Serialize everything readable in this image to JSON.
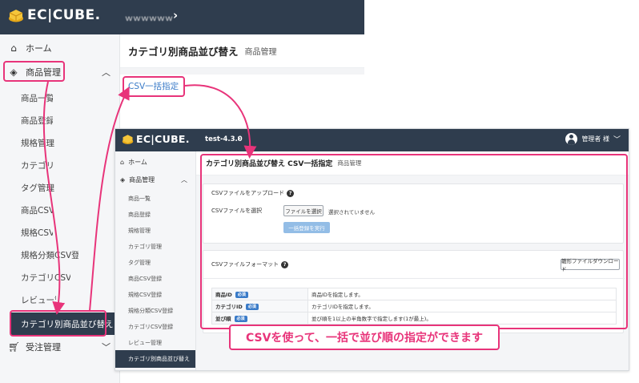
{
  "brand": {
    "logo_text": "EC|CUBE.",
    "accent": "#e8347a",
    "header_bg": "#2f3d4e",
    "link": "#3a7bc8"
  },
  "outer": {
    "shop_name": "ｗｗｗｗｗｗ",
    "nav": {
      "home": "ホーム",
      "products": "商品管理",
      "orders": "受注管理"
    },
    "sub_items": [
      "商品一覧",
      "商品登録",
      "規格管理",
      "カテゴリ管理",
      "タグ管理",
      "商品CSV登録",
      "規格CSV登録",
      "規格分類CSV登録",
      "カテゴリCSV登録",
      "レビュー管理"
    ],
    "active_item": "カテゴリ別商品並び替え",
    "page_title": "カテゴリ別商品並び替え",
    "page_subtitle": "商品管理",
    "csv_link": "CSV一括指定"
  },
  "inner": {
    "shop_name": "test-4.3.0",
    "user_label": "管理者 様",
    "nav": {
      "home": "ホーム",
      "products": "商品管理"
    },
    "sub_items": [
      "商品一覧",
      "商品登録",
      "規格管理",
      "カテゴリ管理",
      "タグ管理",
      "商品CSV登録",
      "規格CSV登録",
      "規格分類CSV登録",
      "カテゴリCSV登録",
      "レビュー管理"
    ],
    "active_item": "カテゴリ別商品並び替え",
    "page_title": "カテゴリ別商品並び替え CSV一括指定",
    "page_subtitle": "商品管理",
    "upload_card": {
      "heading": "CSVファイルをアップロード",
      "file_label": "CSVファイルを選択",
      "choose_button": "ファイルを選択",
      "no_file_text": "選択されていません",
      "submit_button": "一括登録を実行"
    },
    "format_card": {
      "heading": "CSVファイルフォーマット",
      "download_button": "雛形ファイルダウンロード",
      "required_badge": "必須",
      "rows": [
        {
          "field": "商品ID",
          "description": "商品IDを指定します。"
        },
        {
          "field": "カテゴリID",
          "description": "カテゴリIDを指定します。"
        },
        {
          "field": "並び順",
          "description": "並び順を1以上の半角数字で指定します(1が最上)。"
        }
      ]
    }
  },
  "callout": "CSVを使って、一括で並び順の指定ができます"
}
